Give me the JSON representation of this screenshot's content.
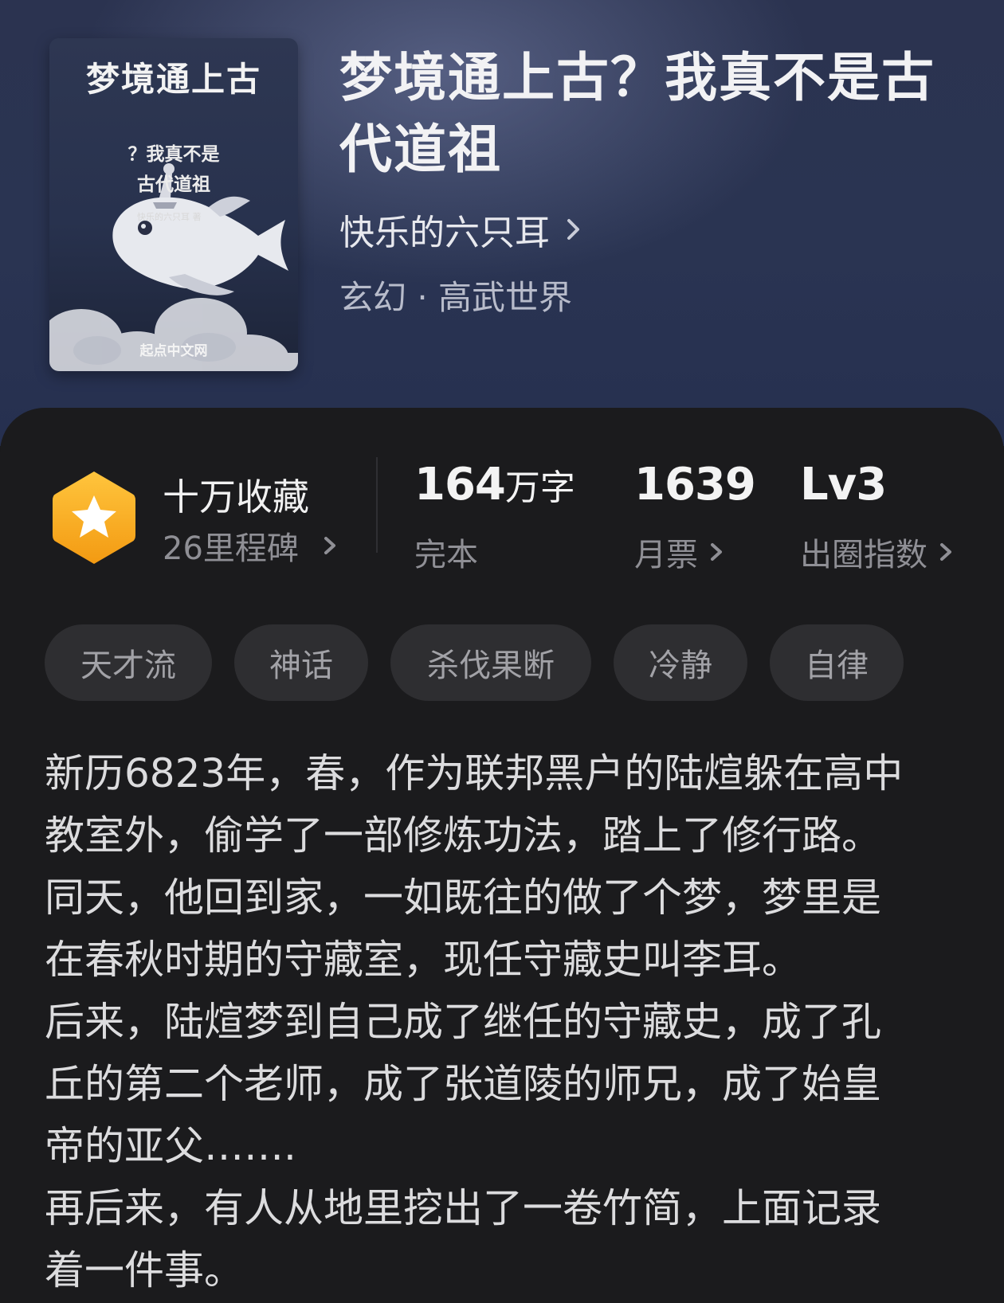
{
  "book": {
    "cover": {
      "title": "梦境通上古",
      "subtitle_line1": "？我真不是",
      "subtitle_line2": "古代道祖",
      "author_line": "快乐的六只耳 著",
      "publisher": "起点中文网"
    },
    "title_line1": "梦境通上古？我真不是古",
    "title_line2": "代道祖",
    "author": "快乐的六只耳",
    "genre": "玄幻 · 高武世界"
  },
  "stats": {
    "collection": "十万收藏",
    "milestones": "26里程碑",
    "word_count_number": "164",
    "word_count_unit": "万字",
    "status": "完本",
    "monthly_tickets_number": "1639",
    "monthly_tickets_label": "月票",
    "influence_level": "Lv3",
    "influence_label": "出圈指数"
  },
  "tags": [
    "天才流",
    "神话",
    "杀伐果断",
    "冷静",
    "自律"
  ],
  "synopsis_lines": [
    "新历6823年，春，作为联邦黑户的陆煊躲在高中",
    "教室外，偷学了一部修炼功法，踏上了修行路。",
    "同天，他回到家，一如既往的做了个梦，梦里是",
    "在春秋时期的守藏室，现任守藏史叫李耳。",
    "后来，陆煊梦到自己成了继任的守藏史，成了孔",
    "丘的第二个老师，成了张道陵的师兄，成了始皇",
    "帝的亚父…….",
    "再后来，有人从地里挖出了一卷竹简，上面记录",
    "着一件事。"
  ],
  "colors": {
    "header_bg": "#2a3452",
    "card_bg": "#1b1b1d",
    "badge_orange": "#f5a623",
    "tag_bg": "#2e2e31"
  }
}
